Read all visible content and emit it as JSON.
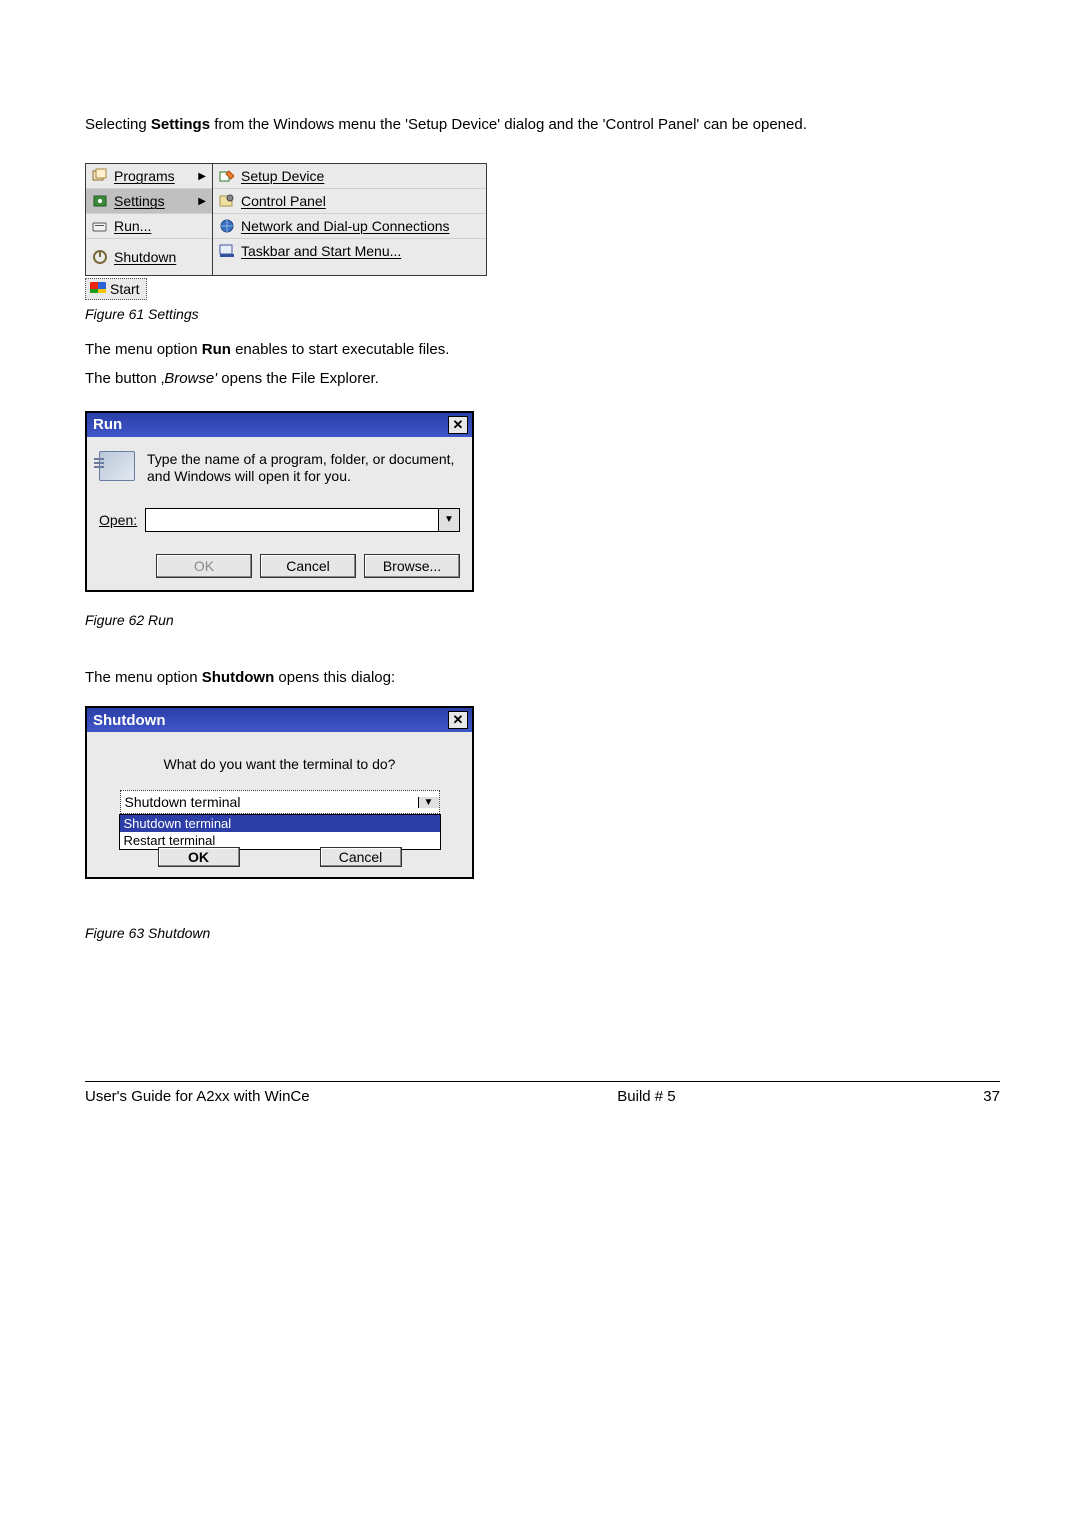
{
  "intro": {
    "pre": "Selecting ",
    "bold": "Settings",
    "post": " from the Windows menu the 'Setup Device' dialog and the 'Control Panel' can be opened."
  },
  "captions": {
    "fig61": "Figure 61 Settings",
    "fig62": "Figure 62 Run",
    "fig63": "Figure 63 Shutdown"
  },
  "startmenu": {
    "left": {
      "programs": "Programs",
      "settings": "Settings",
      "run": "Run...",
      "shutdown": "Shutdown"
    },
    "right": {
      "setup_device": "Setup Device",
      "control_panel": "Control Panel",
      "network": "Network and Dial-up Connections",
      "taskbar": "Taskbar and Start Menu..."
    },
    "start_label": "Start"
  },
  "para_run": {
    "pre": "The menu option ",
    "bold": "Run",
    "post": " enables to start executable files."
  },
  "para_browse": {
    "pre": "The button ‚",
    "italic": "Browse'",
    "post": " opens the File Explorer."
  },
  "run_dialog": {
    "title": "Run",
    "prompt": "Type the name of a program, folder, or document, and Windows will open it for you.",
    "open_label": "Open:",
    "ok": "OK",
    "cancel": "Cancel",
    "browse": "Browse...",
    "value": ""
  },
  "para_shutdown": {
    "pre": "The menu option ",
    "bold": "Shutdown",
    "post": " opens this dialog:"
  },
  "shutdown_dialog": {
    "title": "Shutdown",
    "question": "What do you want the terminal to do?",
    "selected": "Shutdown terminal",
    "options": [
      "Shutdown terminal",
      "Restart terminal"
    ],
    "ok": "OK",
    "cancel": "Cancel"
  },
  "footer": {
    "left": "User's Guide for A2xx with WinCe",
    "center": "Build # 5",
    "right": "37"
  }
}
